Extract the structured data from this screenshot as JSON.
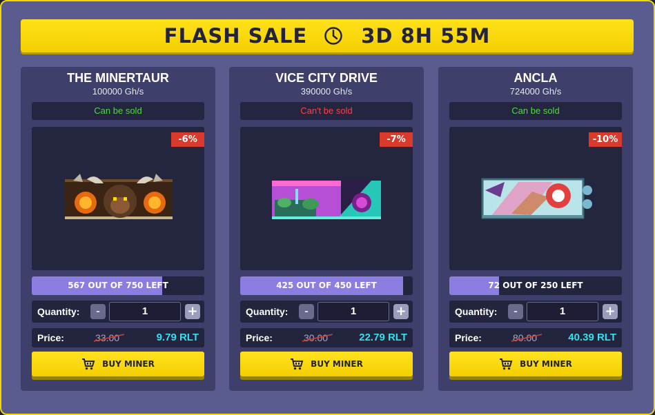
{
  "banner": {
    "title": "FLASH SALE",
    "timer": "3D 8H 55M",
    "icon": "clock-icon"
  },
  "colors": {
    "accent": "#f5d800",
    "can_sell": "#4ddd3a",
    "cannot_sell": "#ff4141",
    "price": "#2fe2f0",
    "discount": "#d83a2c",
    "stock_fill": "#8c7ee0"
  },
  "cards": [
    {
      "name": "THE MINERTAUR",
      "power": "100000 Gh/s",
      "sell_status": "Can be sold",
      "discount": "-6%",
      "stock_label": "567 OUT OF 750 LEFT",
      "stock_fraction": 0.756,
      "quantity_label": "Quantity:",
      "quantity": "1",
      "price_label": "Price:",
      "old_price": "33.00",
      "new_price": "9.79 RLT",
      "buy_label": "BUY MINER"
    },
    {
      "name": "VICE CITY DRIVE",
      "power": "390000 Gh/s",
      "sell_status": "Can't be sold",
      "discount": "-7%",
      "stock_label": "425 OUT OF 450 LEFT",
      "stock_fraction": 0.944,
      "quantity_label": "Quantity:",
      "quantity": "1",
      "price_label": "Price:",
      "old_price": "30.00",
      "new_price": "22.79 RLT",
      "buy_label": "BUY MINER"
    },
    {
      "name": "ANCLA",
      "power": "724000 Gh/s",
      "sell_status": "Can be sold",
      "discount": "-10%",
      "stock_label": "72 OUT OF 250 LEFT",
      "stock_fraction": 0.288,
      "quantity_label": "Quantity:",
      "quantity": "1",
      "price_label": "Price:",
      "old_price": "80.00",
      "new_price": "40.39 RLT",
      "buy_label": "BUY MINER"
    }
  ],
  "controls": {
    "minus": "-",
    "plus": "+"
  }
}
